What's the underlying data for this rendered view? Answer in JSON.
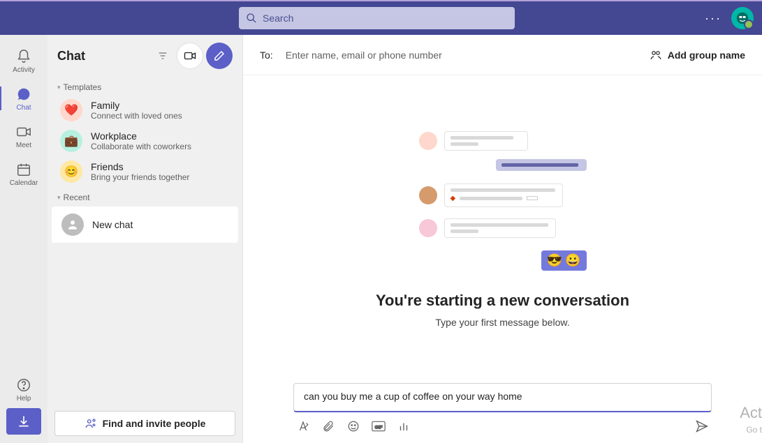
{
  "search": {
    "placeholder": "Search"
  },
  "rail": {
    "items": [
      {
        "label": "Activity"
      },
      {
        "label": "Chat"
      },
      {
        "label": "Meet"
      },
      {
        "label": "Calendar"
      }
    ],
    "help": "Help"
  },
  "panel": {
    "title": "Chat",
    "sections": {
      "templates": "Templates",
      "recent": "Recent"
    },
    "templates": [
      {
        "title": "Family",
        "subtitle": "Connect with loved ones",
        "emoji": "❤️",
        "bg": "#ffd7cc"
      },
      {
        "title": "Workplace",
        "subtitle": "Collaborate with coworkers",
        "emoji": "💼",
        "bg": "#b7f0e0"
      },
      {
        "title": "Friends",
        "subtitle": "Bring your friends together",
        "emoji": "😊",
        "bg": "#ffe8a3"
      }
    ],
    "recent": [
      {
        "title": "New chat"
      }
    ],
    "invite": "Find and invite people"
  },
  "conversation": {
    "to_label": "To:",
    "to_placeholder": "Enter name, email or phone number",
    "add_group": "Add group name",
    "heading": "You're starting a new conversation",
    "subheading": "Type your first message below.",
    "compose_value": "can you buy me a cup of coffee on your way home"
  },
  "watermark": {
    "title": "Act",
    "sub": "Go t"
  }
}
